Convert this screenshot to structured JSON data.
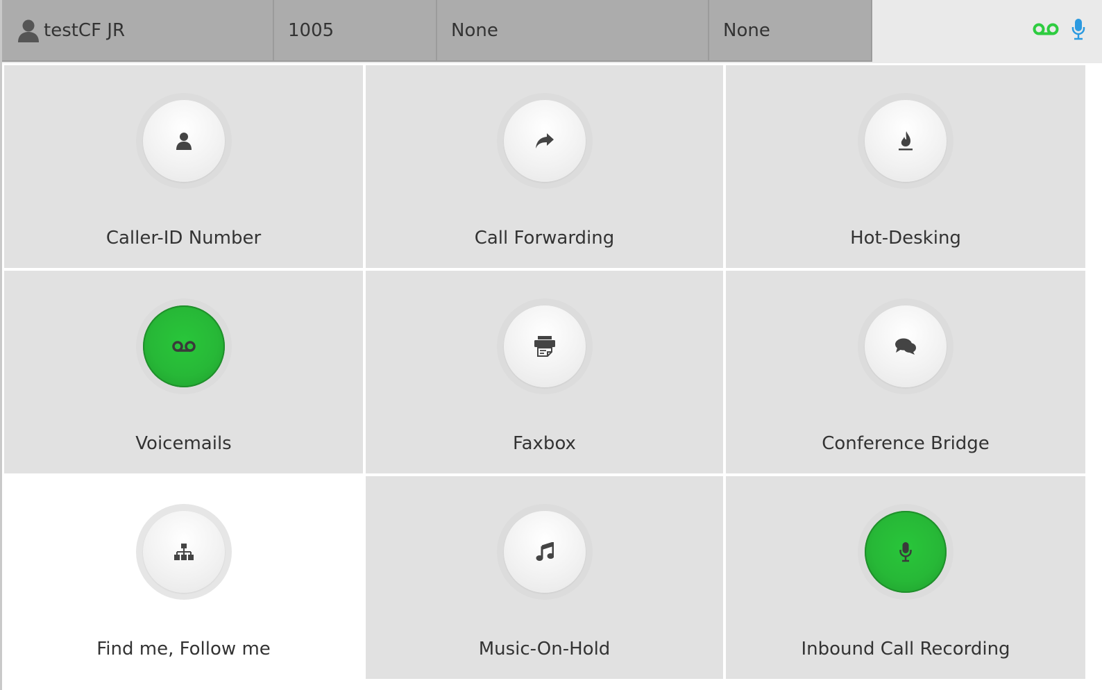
{
  "header": {
    "user_name": "testCF JR",
    "extension": "1005",
    "field_3": "None",
    "field_4": "None",
    "status_icons": [
      "voicemail-icon",
      "microphone-icon"
    ],
    "colors": {
      "voicemail": "#2ecc40",
      "microphone": "#2b9ae0"
    }
  },
  "tiles": [
    {
      "label": "Caller-ID Number",
      "icon": "user-icon",
      "enabled": false
    },
    {
      "label": "Call Forwarding",
      "icon": "share-arrow-icon",
      "enabled": false
    },
    {
      "label": "Hot-Desking",
      "icon": "fire-icon",
      "enabled": false
    },
    {
      "label": "Voicemails",
      "icon": "voicemail-icon",
      "enabled": true
    },
    {
      "label": "Faxbox",
      "icon": "fax-icon",
      "enabled": false
    },
    {
      "label": "Conference Bridge",
      "icon": "comments-icon",
      "enabled": false
    },
    {
      "label": "Find me, Follow me",
      "icon": "sitemap-icon",
      "enabled": false,
      "selected": true
    },
    {
      "label": "Music-On-Hold",
      "icon": "music-note-icon",
      "enabled": false
    },
    {
      "label": "Inbound Call Recording",
      "icon": "microphone-icon",
      "enabled": true
    }
  ],
  "colors": {
    "enabled": "#27b837",
    "tile_bg": "#e1e1e1",
    "header_bg": "#acacac"
  }
}
